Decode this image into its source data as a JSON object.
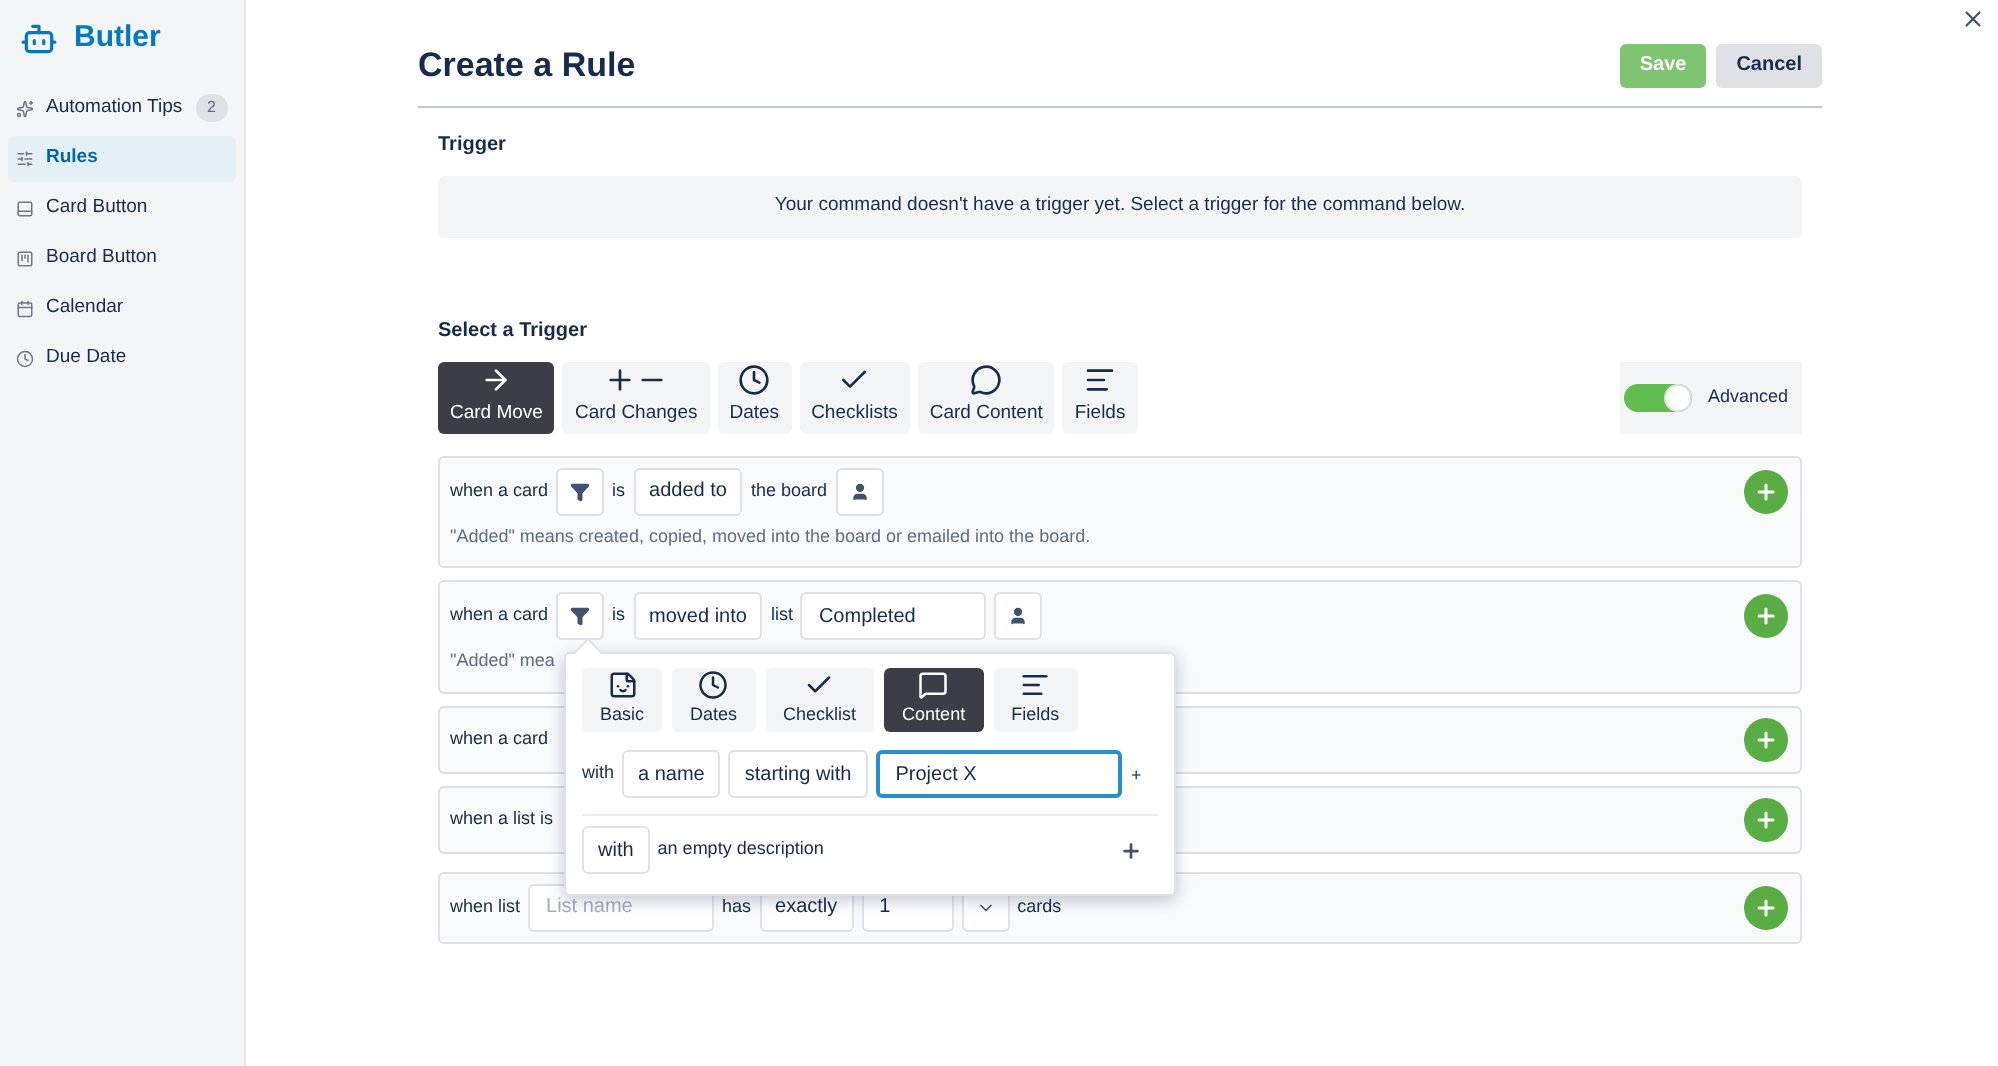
{
  "sidebar": {
    "brand": "Butler",
    "items": [
      {
        "label": "Automation Tips",
        "badge": "2",
        "selected": false
      },
      {
        "label": "Rules",
        "selected": true
      },
      {
        "label": "Card Button",
        "selected": false
      },
      {
        "label": "Board Button",
        "selected": false
      },
      {
        "label": "Calendar",
        "selected": false
      },
      {
        "label": "Due Date",
        "selected": false
      }
    ]
  },
  "header": {
    "title": "Create a Rule",
    "buttons": [
      {
        "label": "Save",
        "kind": "primary",
        "disabled": true
      },
      {
        "label": "Cancel",
        "kind": "secondary",
        "disabled": false
      }
    ]
  },
  "trigger": {
    "heading": "Trigger",
    "message": "Your command doesn't have a trigger yet. Select a trigger for the command below."
  },
  "select_trigger": {
    "heading": "Select a Trigger",
    "tabs": [
      {
        "label": "Card Move",
        "selected": true
      },
      {
        "label": "Card Changes",
        "selected": false
      },
      {
        "label": "Dates",
        "selected": false
      },
      {
        "label": "Checklists",
        "selected": false
      },
      {
        "label": "Card Content",
        "selected": false
      },
      {
        "label": "Fields",
        "selected": false
      }
    ],
    "advanced": {
      "label": "Advanced",
      "on": true
    }
  },
  "rules": [
    {
      "parts": [
        {
          "kind": "text",
          "text": "when a card"
        },
        {
          "kind": "filter"
        },
        {
          "kind": "text",
          "text": "is"
        },
        {
          "kind": "select",
          "text": "added to"
        },
        {
          "kind": "text",
          "text": "the board"
        },
        {
          "kind": "person"
        }
      ],
      "note": "\"Added\" means created, copied, moved into the board or emailed into the board."
    },
    {
      "parts": [
        {
          "kind": "text",
          "text": "when a card"
        },
        {
          "kind": "filter"
        },
        {
          "kind": "text",
          "text": "is"
        },
        {
          "kind": "select",
          "text": "moved into"
        },
        {
          "kind": "text",
          "text": "list"
        },
        {
          "kind": "input",
          "value": "Completed"
        },
        {
          "kind": "person"
        }
      ],
      "note": "\"Added\" mea",
      "popover": {
        "tabs": [
          {
            "label": "Basic",
            "selected": false
          },
          {
            "label": "Dates",
            "selected": false
          },
          {
            "label": "Checklist",
            "selected": false
          },
          {
            "label": "Content",
            "selected": true
          },
          {
            "label": "Fields",
            "selected": false
          }
        ],
        "conditions": [
          {
            "parts": [
              {
                "kind": "text",
                "text": "with"
              },
              {
                "kind": "select",
                "text": "a name"
              },
              {
                "kind": "select",
                "text": "starting with"
              },
              {
                "kind": "input",
                "value": "Project X",
                "focused": true
              }
            ]
          },
          {
            "parts": [
              {
                "kind": "select",
                "text": "with"
              },
              {
                "kind": "text",
                "text": "an empty description"
              }
            ]
          }
        ]
      }
    },
    {
      "parts": [
        {
          "kind": "text",
          "text": "when a card"
        }
      ]
    },
    {
      "parts": [
        {
          "kind": "text",
          "text": "when a list is"
        }
      ]
    },
    {
      "parts": [
        {
          "kind": "text",
          "text": "when list"
        },
        {
          "kind": "input",
          "placeholder": "List name"
        },
        {
          "kind": "text",
          "text": "has"
        },
        {
          "kind": "select",
          "text": "exactly"
        },
        {
          "kind": "input",
          "value": "1"
        },
        {
          "kind": "caret"
        },
        {
          "kind": "text",
          "text": "cards"
        }
      ]
    }
  ]
}
